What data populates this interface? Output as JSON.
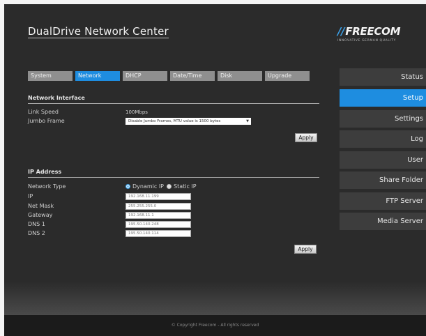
{
  "header": {
    "title": "DualDrive Network Center",
    "logo_text": "FREECOM",
    "logo_mark": "//",
    "tagline": "INNOVATIVE GERMAN QUALITY"
  },
  "tabs": [
    {
      "label": "System",
      "active": false
    },
    {
      "label": "Network",
      "active": true
    },
    {
      "label": "DHCP",
      "active": false
    },
    {
      "label": "Date/Time",
      "active": false
    },
    {
      "label": "Disk",
      "active": false
    },
    {
      "label": "Upgrade",
      "active": false
    }
  ],
  "network_interface": {
    "title": "Network Interface",
    "link_speed_label": "Link Speed",
    "link_speed_value": "100Mbps",
    "jumbo_frame_label": "Jumbo Frame",
    "jumbo_frame_selected": "Disable Jumbo Frames, MTU value is 1500 bytes",
    "apply_label": "Apply"
  },
  "ip_address": {
    "title": "IP Address",
    "network_type_label": "Network Type",
    "dynamic_ip_label": "Dynamic IP",
    "static_ip_label": "Static IP",
    "dynamic_selected": true,
    "ip_label": "IP",
    "ip_value": "192.168.11.199",
    "netmask_label": "Net Mask",
    "netmask_value": "255.255.255.0",
    "gateway_label": "Gateway",
    "gateway_value": "192.168.11.1",
    "dns1_label": "DNS 1",
    "dns1_value": "195.50.140.248",
    "dns2_label": "DNS 2",
    "dns2_value": "195.50.140.114",
    "apply_label": "Apply"
  },
  "sidebar": {
    "items": [
      {
        "label": "Status",
        "active": false
      },
      {
        "label": "Setup",
        "active": true
      },
      {
        "label": "Settings",
        "active": false
      },
      {
        "label": "Log",
        "active": false
      },
      {
        "label": "User",
        "active": false
      },
      {
        "label": "Share Folder",
        "active": false
      },
      {
        "label": "FTP Server",
        "active": false
      },
      {
        "label": "Media Server",
        "active": false
      }
    ]
  },
  "footer": {
    "text": "© Copyright Freecom - All rights reserved"
  },
  "colors": {
    "accent": "#1e8de0",
    "background": "#2b2b2b",
    "tab_inactive": "#8f8f8f"
  }
}
